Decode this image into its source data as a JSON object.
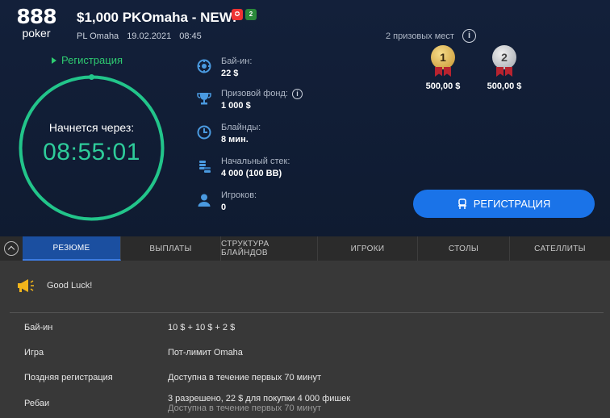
{
  "logo": {
    "big": "888",
    "small": "poker"
  },
  "title": "$1,000 PKOmaha - NEW!",
  "badges": {
    "pko": "",
    "two": "2"
  },
  "subtitle": {
    "game": "PL Omaha",
    "date": "19.02.2021",
    "time": "08:45"
  },
  "registration_status": "Регистрация",
  "timer": {
    "label": "Начнется через:",
    "time": "08:55:01",
    "progress": 1.0
  },
  "info": {
    "buyin": {
      "label": "Бай-ин:",
      "value": "22 $"
    },
    "prize_pool": {
      "label": "Призовой фонд:",
      "value": "1 000 $"
    },
    "blinds": {
      "label": "Блайнды:",
      "value": "8 мин."
    },
    "stack": {
      "label": "Начальный стек:",
      "value": "4 000 (100 BB)"
    },
    "players": {
      "label": "Игроков:",
      "value": "0"
    }
  },
  "prizes": {
    "count_label": "2 призовых мест",
    "places": [
      {
        "place": "1",
        "amount": "500,00 $"
      },
      {
        "place": "2",
        "amount": "500,00 $"
      }
    ]
  },
  "register_button": "РЕГИСТРАЦИЯ",
  "tabs": [
    "РЕЗЮМЕ",
    "ВЫПЛАТЫ",
    "СТРУКТУРА БЛАЙНДОВ",
    "ИГРОКИ",
    "СТОЛЫ",
    "САТЕЛЛИТЫ"
  ],
  "message": "Good Luck!",
  "details": [
    {
      "key": "Бай-ин",
      "value": "10 $ + 10 $ + 2 $"
    },
    {
      "key": "Игра",
      "value": "Пот-лимит Omaha"
    },
    {
      "key": "Поздняя регистрация",
      "value": "Доступна в течение первых 70 минут"
    },
    {
      "key": "Ребаи",
      "value": "3 разрешено, 22 $ для покупки 4 000 фишек",
      "value2": "Доступна в течение первых 70 минут"
    }
  ],
  "colors": {
    "accent": "#2ecc9a",
    "button": "#1a73e8",
    "active_tab": "#1b4fa0"
  }
}
